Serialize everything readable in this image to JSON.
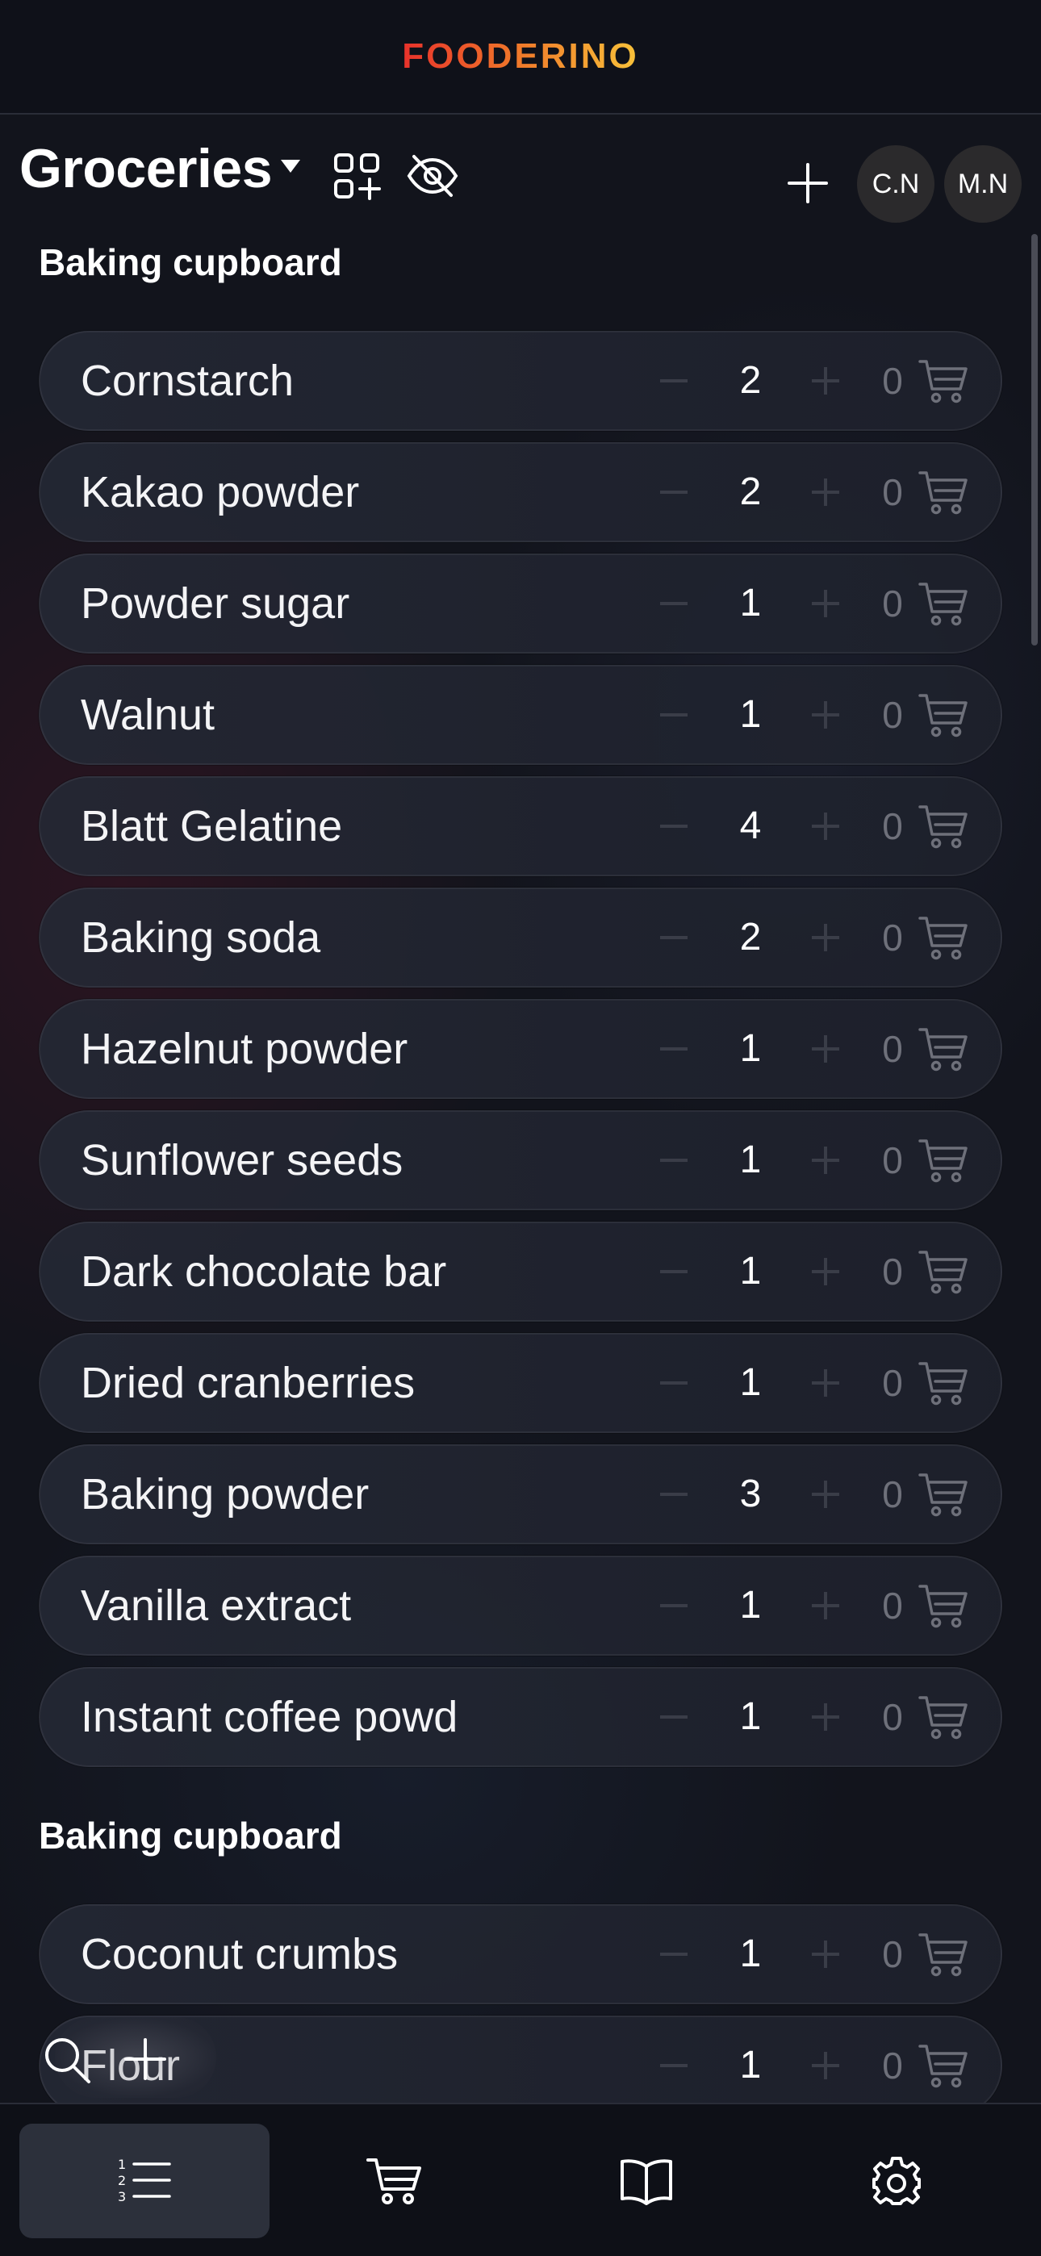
{
  "app": {
    "brand": "FOODERINO"
  },
  "header": {
    "title": "Groceries",
    "caret_icon": "caret-down-icon",
    "category_icon": "category-grid-add-icon",
    "visibility_icon": "eye-off-icon",
    "add_icon": "plus-icon",
    "members": [
      "C.N",
      "M.N"
    ]
  },
  "sections": [
    {
      "title": "Baking cupboard",
      "items": [
        {
          "name": "Cornstarch",
          "qty": "2",
          "cart": "0"
        },
        {
          "name": "Kakao powder",
          "qty": "2",
          "cart": "0"
        },
        {
          "name": "Powder sugar",
          "qty": "1",
          "cart": "0"
        },
        {
          "name": "Walnut",
          "qty": "1",
          "cart": "0"
        },
        {
          "name": "Blatt Gelatine",
          "qty": "4",
          "cart": "0"
        },
        {
          "name": "Baking soda",
          "qty": "2",
          "cart": "0"
        },
        {
          "name": "Hazelnut powder",
          "qty": "1",
          "cart": "0"
        },
        {
          "name": "Sunflower seeds",
          "qty": "1",
          "cart": "0"
        },
        {
          "name": "Dark chocolate bar",
          "qty": "1",
          "cart": "0"
        },
        {
          "name": "Dried cranberries",
          "qty": "1",
          "cart": "0"
        },
        {
          "name": "Baking powder",
          "qty": "3",
          "cart": "0"
        },
        {
          "name": "Vanilla extract",
          "qty": "1",
          "cart": "0"
        },
        {
          "name": "Instant coffee powd",
          "qty": "1",
          "cart": "0"
        }
      ]
    },
    {
      "title": "Baking cupboard",
      "items": [
        {
          "name": "Coconut crumbs",
          "qty": "1",
          "cart": "0"
        },
        {
          "name": "Flour",
          "qty": "1",
          "cart": "0"
        }
      ]
    }
  ],
  "fab": {
    "search_icon": "search-icon",
    "add_icon": "plus-icon"
  },
  "bottom_nav": [
    {
      "name": "list",
      "icon": "numbered-list-icon",
      "active": true
    },
    {
      "name": "cart",
      "icon": "cart-icon",
      "active": false
    },
    {
      "name": "recipes",
      "icon": "book-icon",
      "active": false
    },
    {
      "name": "settings",
      "icon": "gear-icon",
      "active": false
    }
  ],
  "colors": {
    "background": "#12141c",
    "bar": "#0f1119",
    "brand_start": "#e8322b",
    "brand_end": "#f8c23a",
    "muted": "#6e707a"
  }
}
